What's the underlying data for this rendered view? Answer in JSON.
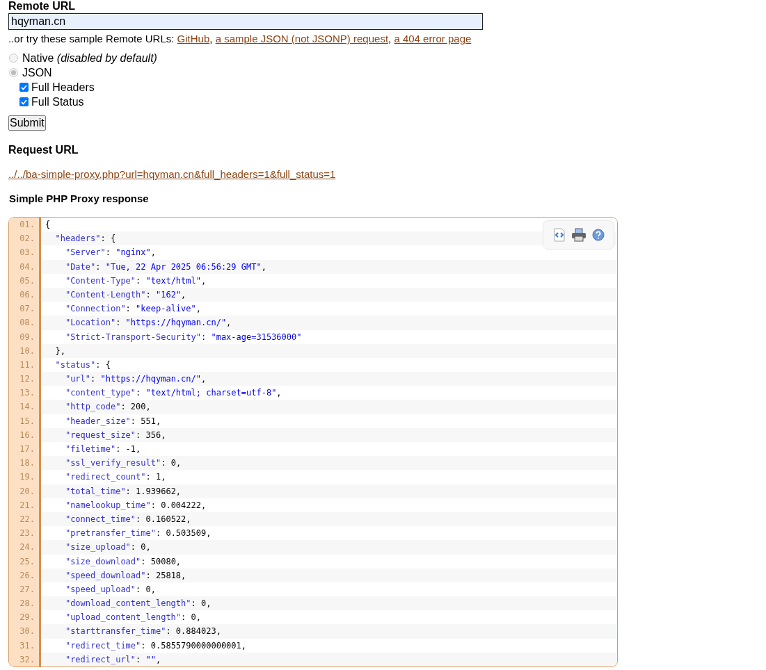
{
  "remote_url": {
    "heading": "Remote URL",
    "value": "hqyman.cn"
  },
  "samples": {
    "prefix": "..or try these sample Remote URLs: ",
    "links": [
      "GitHub",
      "a sample JSON (not JSONP) request",
      "a 404 error page"
    ],
    "separator": ", "
  },
  "modes": [
    {
      "label": "Native",
      "note": "(disabled by default)",
      "selected": false,
      "disabled": true
    },
    {
      "label": "JSON",
      "selected": true,
      "disabled": true
    }
  ],
  "options": [
    {
      "label": "Full Headers",
      "checked": true
    },
    {
      "label": "Full Status",
      "checked": true
    }
  ],
  "submit": "Submit",
  "request": {
    "heading": "Request URL",
    "url": "../../ba-simple-proxy.php?url=hqyman.cn&full_headers=1&full_status=1"
  },
  "response": {
    "heading": "Simple PHP Proxy response",
    "lines": [
      {
        "number": "01.",
        "code": "{"
      },
      {
        "number": "02.",
        "code": "  \"headers\": {"
      },
      {
        "number": "03.",
        "code": "    \"Server\": \"nginx\","
      },
      {
        "number": "04.",
        "code": "    \"Date\": \"Tue, 22 Apr 2025 06:56:29 GMT\","
      },
      {
        "number": "05.",
        "code": "    \"Content-Type\": \"text/html\","
      },
      {
        "number": "06.",
        "code": "    \"Content-Length\": \"162\","
      },
      {
        "number": "07.",
        "code": "    \"Connection\": \"keep-alive\","
      },
      {
        "number": "08.",
        "code": "    \"Location\": \"https://hqyman.cn/\","
      },
      {
        "number": "09.",
        "code": "    \"Strict-Transport-Security\": \"max-age=31536000\""
      },
      {
        "number": "10.",
        "code": "  },"
      },
      {
        "number": "11.",
        "code": "  \"status\": {"
      },
      {
        "number": "12.",
        "code": "    \"url\": \"https://hqyman.cn/\","
      },
      {
        "number": "13.",
        "code": "    \"content_type\": \"text/html; charset=utf-8\","
      },
      {
        "number": "14.",
        "code": "    \"http_code\": 200,"
      },
      {
        "number": "15.",
        "code": "    \"header_size\": 551,"
      },
      {
        "number": "16.",
        "code": "    \"request_size\": 356,"
      },
      {
        "number": "17.",
        "code": "    \"filetime\": -1,"
      },
      {
        "number": "18.",
        "code": "    \"ssl_verify_result\": 0,"
      },
      {
        "number": "19.",
        "code": "    \"redirect_count\": 1,"
      },
      {
        "number": "20.",
        "code": "    \"total_time\": 1.939662,"
      },
      {
        "number": "21.",
        "code": "    \"namelookup_time\": 0.004222,"
      },
      {
        "number": "22.",
        "code": "    \"connect_time\": 0.160522,"
      },
      {
        "number": "23.",
        "code": "    \"pretransfer_time\": 0.503509,"
      },
      {
        "number": "24.",
        "code": "    \"size_upload\": 0,"
      },
      {
        "number": "25.",
        "code": "    \"size_download\": 50080,"
      },
      {
        "number": "26.",
        "code": "    \"speed_download\": 25818,"
      },
      {
        "number": "27.",
        "code": "    \"speed_upload\": 0,"
      },
      {
        "number": "28.",
        "code": "    \"download_content_length\": 0,"
      },
      {
        "number": "29.",
        "code": "    \"upload_content_length\": 0,"
      },
      {
        "number": "30.",
        "code": "    \"starttransfer_time\": 0.884023,"
      },
      {
        "number": "31.",
        "code": "    \"redirect_time\": 0.5855790000000001,"
      },
      {
        "number": "32.",
        "code": "    \"redirect_url\": \"\","
      }
    ]
  }
}
